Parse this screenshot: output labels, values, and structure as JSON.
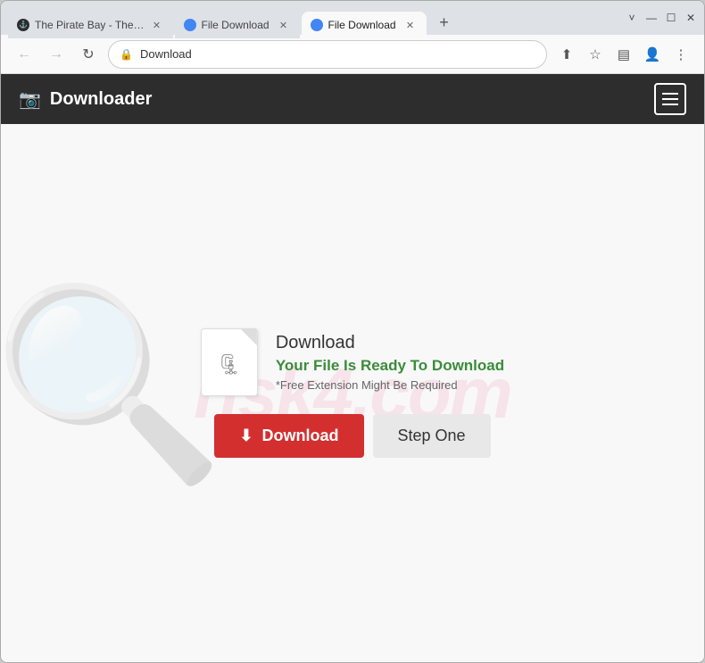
{
  "browser": {
    "tabs": [
      {
        "id": "tab-1",
        "title": "The Pirate Bay - The…",
        "favicon_type": "pirate",
        "active": false
      },
      {
        "id": "tab-2",
        "title": "File Download",
        "favicon_type": "blue",
        "active": false
      },
      {
        "id": "tab-3",
        "title": "File Download",
        "favicon_type": "blue",
        "active": true
      }
    ],
    "window_controls": {
      "chevron_down": "˅",
      "minimize": "—",
      "maximize": "☐",
      "close": "✕"
    },
    "nav": {
      "back_disabled": true,
      "forward_disabled": true,
      "address": "Download",
      "lock_icon": "🔒"
    }
  },
  "navbar": {
    "brand_icon": "📷",
    "brand_label": "Downloader",
    "hamburger_label": "Menu"
  },
  "main": {
    "file_icon_char": "🗜",
    "file_label": "Download",
    "file_ready": "Your File Is Ready To Download",
    "file_note": "*Free Extension Might Be Required",
    "download_btn_icon": "⬇",
    "download_btn_label": "Download",
    "step_one_btn_label": "Step One"
  },
  "watermark": {
    "text": "risk4.com",
    "search_unicode": "🔍"
  }
}
